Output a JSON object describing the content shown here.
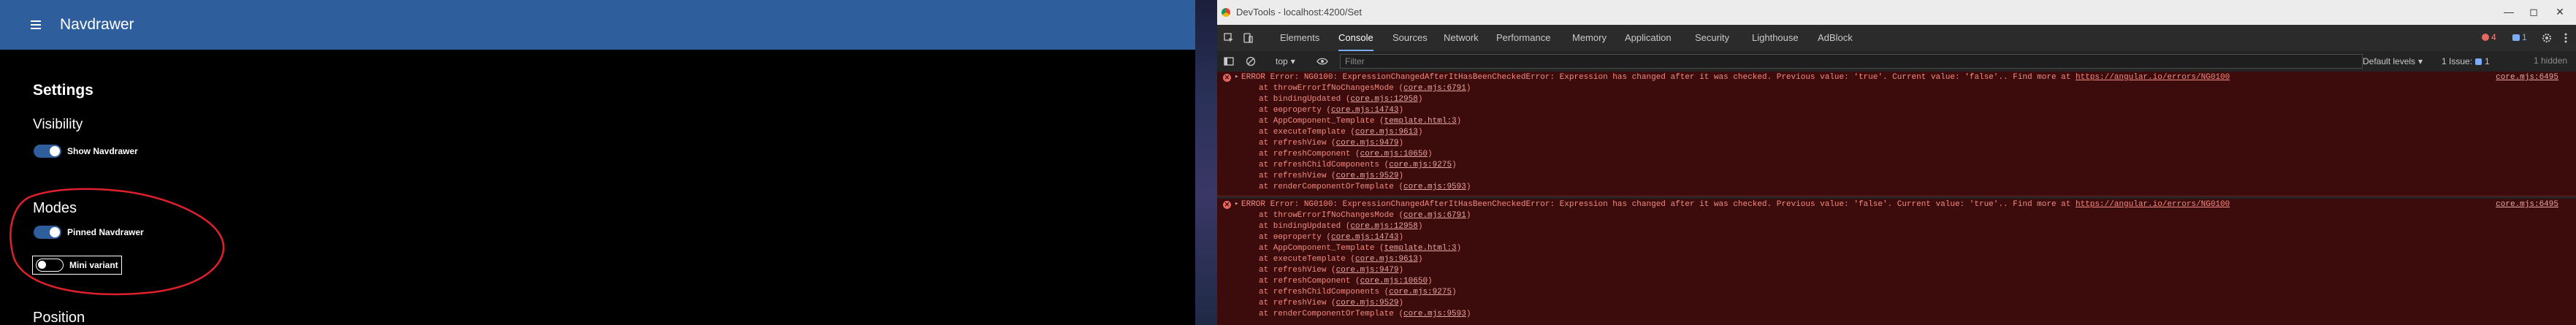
{
  "app": {
    "title": "Navdrawer",
    "menu_icon": "hamburger-menu-icon",
    "header_color": "#2f5e9d",
    "settings_title": "Settings",
    "visibility_title": "Visibility",
    "show_navdrawer_label": "Show Navdrawer",
    "show_navdrawer_on": true,
    "modes_title": "Modes",
    "pinned_label": "Pinned Navdrawer",
    "pinned_on": true,
    "mini_label": "Mini variant",
    "mini_on": false,
    "position_title": "Position",
    "annotation_color": "#e0202c"
  },
  "devtools": {
    "window_title": "DevTools - localhost:4200/Set",
    "tabs": [
      {
        "label": "Elements",
        "active": false
      },
      {
        "label": "Console",
        "active": true
      },
      {
        "label": "Sources",
        "active": false
      },
      {
        "label": "Network",
        "active": false
      },
      {
        "label": "Performance",
        "active": false
      },
      {
        "label": "Memory",
        "active": false
      },
      {
        "label": "Application",
        "active": false
      },
      {
        "label": "Security",
        "active": false
      },
      {
        "label": "Lighthouse",
        "active": false
      },
      {
        "label": "AdBlock",
        "active": false
      }
    ],
    "error_count": "4",
    "message_count": "1",
    "context": "top",
    "filter_placeholder": "Filter",
    "levels": "Default levels",
    "issues_label": "1 Issue:",
    "issues_count": "1",
    "hidden_label": "1 hidden",
    "errors": [
      {
        "message": "ERROR Error: NG0100: ExpressionChangedAfterItHasBeenCheckedError: Expression has changed after it was checked. Previous value: 'true'. Current value: 'false'.. Find more at ",
        "link": "https://angular.io/errors/NG0100",
        "source": "core.mjs:6495",
        "stack": [
          {
            "fn": "at throwErrorIfNoChangesMode",
            "loc": "core.mjs:6791"
          },
          {
            "fn": "at bindingUpdated",
            "loc": "core.mjs:12958"
          },
          {
            "fn": "at ɵɵproperty",
            "loc": "core.mjs:14743"
          },
          {
            "fn": "at AppComponent_Template",
            "loc": "template.html:3"
          },
          {
            "fn": "at executeTemplate",
            "loc": "core.mjs:9613"
          },
          {
            "fn": "at refreshView",
            "loc": "core.mjs:9479"
          },
          {
            "fn": "at refreshComponent",
            "loc": "core.mjs:10650"
          },
          {
            "fn": "at refreshChildComponents",
            "loc": "core.mjs:9275"
          },
          {
            "fn": "at refreshView",
            "loc": "core.mjs:9529"
          },
          {
            "fn": "at renderComponentOrTemplate",
            "loc": "core.mjs:9593"
          }
        ]
      },
      {
        "message": "ERROR Error: NG0100: ExpressionChangedAfterItHasBeenCheckedError: Expression has changed after it was checked. Previous value: 'false'. Current value: 'true'.. Find more at ",
        "link": "https://angular.io/errors/NG0100",
        "source": "core.mjs:6495",
        "stack": [
          {
            "fn": "at throwErrorIfNoChangesMode",
            "loc": "core.mjs:6791"
          },
          {
            "fn": "at bindingUpdated",
            "loc": "core.mjs:12958"
          },
          {
            "fn": "at ɵɵproperty",
            "loc": "core.mjs:14743"
          },
          {
            "fn": "at AppComponent_Template",
            "loc": "template.html:3"
          },
          {
            "fn": "at executeTemplate",
            "loc": "core.mjs:9613"
          },
          {
            "fn": "at refreshView",
            "loc": "core.mjs:9479"
          },
          {
            "fn": "at refreshComponent",
            "loc": "core.mjs:10650"
          },
          {
            "fn": "at refreshChildComponents",
            "loc": "core.mjs:9275"
          },
          {
            "fn": "at refreshView",
            "loc": "core.mjs:9529"
          },
          {
            "fn": "at renderComponentOrTemplate",
            "loc": "core.mjs:9593"
          }
        ]
      }
    ]
  }
}
